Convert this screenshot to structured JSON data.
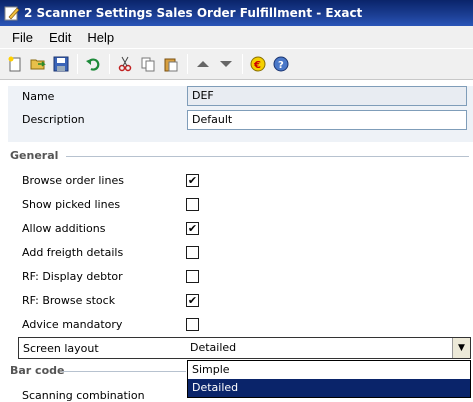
{
  "window": {
    "title": "2 Scanner Settings Sales Order Fulfillment - Exact"
  },
  "menu": [
    "File",
    "Edit",
    "Help"
  ],
  "toolbar": {
    "icons": [
      "new-icon",
      "open-icon",
      "save-icon",
      "undo-icon",
      "cut-icon",
      "copy-icon",
      "paste-icon",
      "move-up-icon",
      "move-down-icon",
      "exact-logo-icon",
      "help-icon"
    ]
  },
  "header": {
    "name_label": "Name",
    "name_value": "DEF",
    "description_label": "Description",
    "description_value": "Default"
  },
  "general": {
    "title": "General",
    "rows": [
      {
        "label": "Browse order lines",
        "checked": true
      },
      {
        "label": "Show picked lines",
        "checked": false
      },
      {
        "label": "Allow additions",
        "checked": true
      },
      {
        "label": "Add freigth details",
        "checked": false
      },
      {
        "label": "RF: Display debtor",
        "checked": false
      },
      {
        "label": "RF: Browse stock",
        "checked": true
      },
      {
        "label": "Advice mandatory",
        "checked": false
      }
    ],
    "screen_layout_label": "Screen layout",
    "screen_layout_value": "Detailed",
    "screen_layout_options": [
      "Simple",
      "Detailed"
    ]
  },
  "barcode": {
    "title": "Bar code",
    "scanning_label": "Scanning combination"
  },
  "check_glyph": "✔"
}
